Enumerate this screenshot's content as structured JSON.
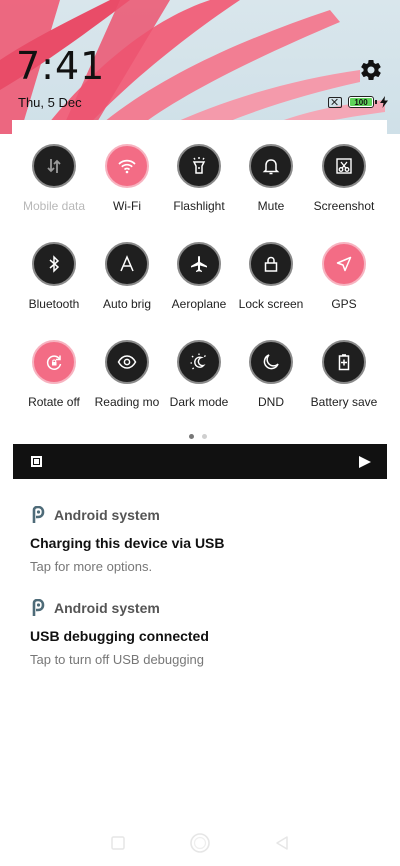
{
  "status": {
    "time": "7:41",
    "date": "Thu, 5 Dec",
    "battery_level": "100",
    "icons": [
      "sim-off-icon",
      "battery-icon",
      "charging-bolt-icon",
      "settings-gear-icon"
    ]
  },
  "quick_settings": {
    "tiles": [
      {
        "label": "Mobile data",
        "icon": "mobile-data-icon",
        "active": false,
        "disabled": true
      },
      {
        "label": "Wi-Fi",
        "icon": "wifi-icon",
        "active": true
      },
      {
        "label": "Flashlight",
        "icon": "flashlight-icon",
        "active": false
      },
      {
        "label": "Mute",
        "icon": "bell-icon",
        "active": false
      },
      {
        "label": "Screenshot",
        "icon": "scissors-icon",
        "active": false
      },
      {
        "label": "Bluetooth",
        "icon": "bluetooth-icon",
        "active": false
      },
      {
        "label": "Auto brig",
        "icon": "auto-brightness-icon",
        "active": false
      },
      {
        "label": "Aeroplane",
        "icon": "airplane-icon",
        "active": false
      },
      {
        "label": "Lock screen",
        "icon": "lock-icon",
        "active": false
      },
      {
        "label": "GPS",
        "icon": "location-arrow-icon",
        "active": true
      },
      {
        "label": "Rotate off",
        "icon": "rotate-lock-icon",
        "active": true
      },
      {
        "label": "Reading mo",
        "icon": "eye-icon",
        "active": false
      },
      {
        "label": "Dark mode",
        "icon": "dark-mode-icon",
        "active": false
      },
      {
        "label": "DND",
        "icon": "moon-icon",
        "active": false
      },
      {
        "label": "Battery save",
        "icon": "battery-saver-icon",
        "active": false
      }
    ],
    "pages": 2,
    "current_page": 1
  },
  "media": {
    "stop_icon": "stop-icon",
    "play_icon": "play-icon"
  },
  "notifications": [
    {
      "app": "Android system",
      "title": "Charging this device via USB",
      "text": "Tap for more options."
    },
    {
      "app": "Android system",
      "title": "USB debugging connected",
      "text": "Tap to turn off USB debugging"
    }
  ],
  "nav": {
    "icons": [
      "recents-icon",
      "home-icon",
      "back-icon"
    ]
  },
  "colors": {
    "accent": "#f36c85",
    "tile_dark": "#1f1f1f",
    "battery_green": "#5fd35a"
  }
}
